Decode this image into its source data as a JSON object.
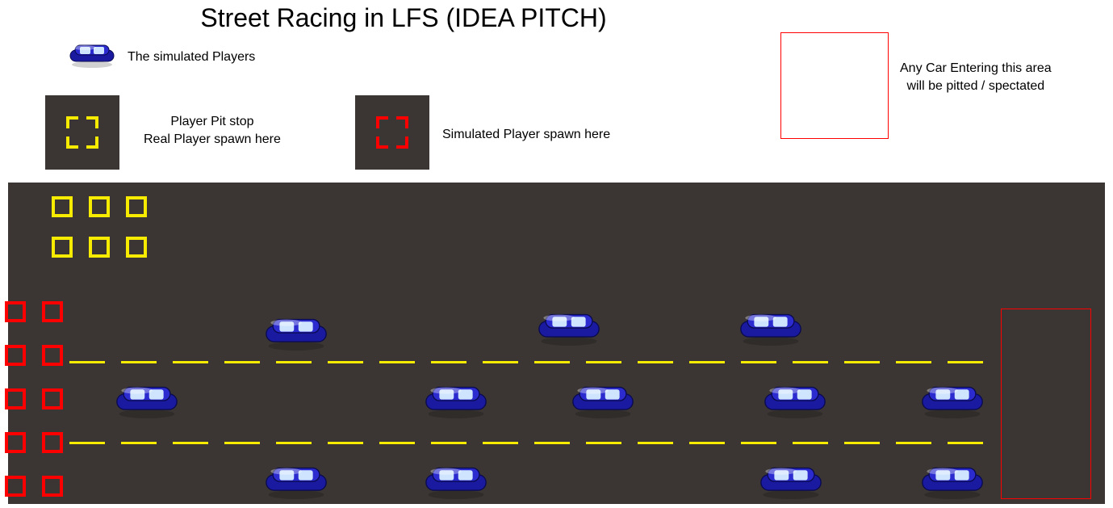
{
  "title": "Street Racing in LFS (IDEA PITCH)",
  "legend": {
    "simulated_players": "The simulated Players",
    "player_pit": {
      "line1": "Player Pit stop",
      "line2": "Real Player spawn here"
    },
    "sim_spawn": "Simulated Player spawn here",
    "pit_zone": {
      "line1": "Any Car Entering this area",
      "line2": "will be pitted / spectated"
    }
  },
  "colors": {
    "road": "#3b3634",
    "lane_marking": "#f7ec00",
    "pit_marker": "#f7ec00",
    "spawn_marker": "#ff0000",
    "zone_border": "#ff0000",
    "car_body": "#1a1aa0"
  },
  "road": {
    "pit_markers_yellow": {
      "rows": 2,
      "cols": 3
    },
    "spawn_markers_red": {
      "rows": 5,
      "cols": 2
    },
    "lane_lines": 2,
    "cars": {
      "top_row": 3,
      "middle_row": 5,
      "bottom_row": 4,
      "total": 12
    },
    "pit_spectate_zone": {
      "side": "right"
    }
  }
}
